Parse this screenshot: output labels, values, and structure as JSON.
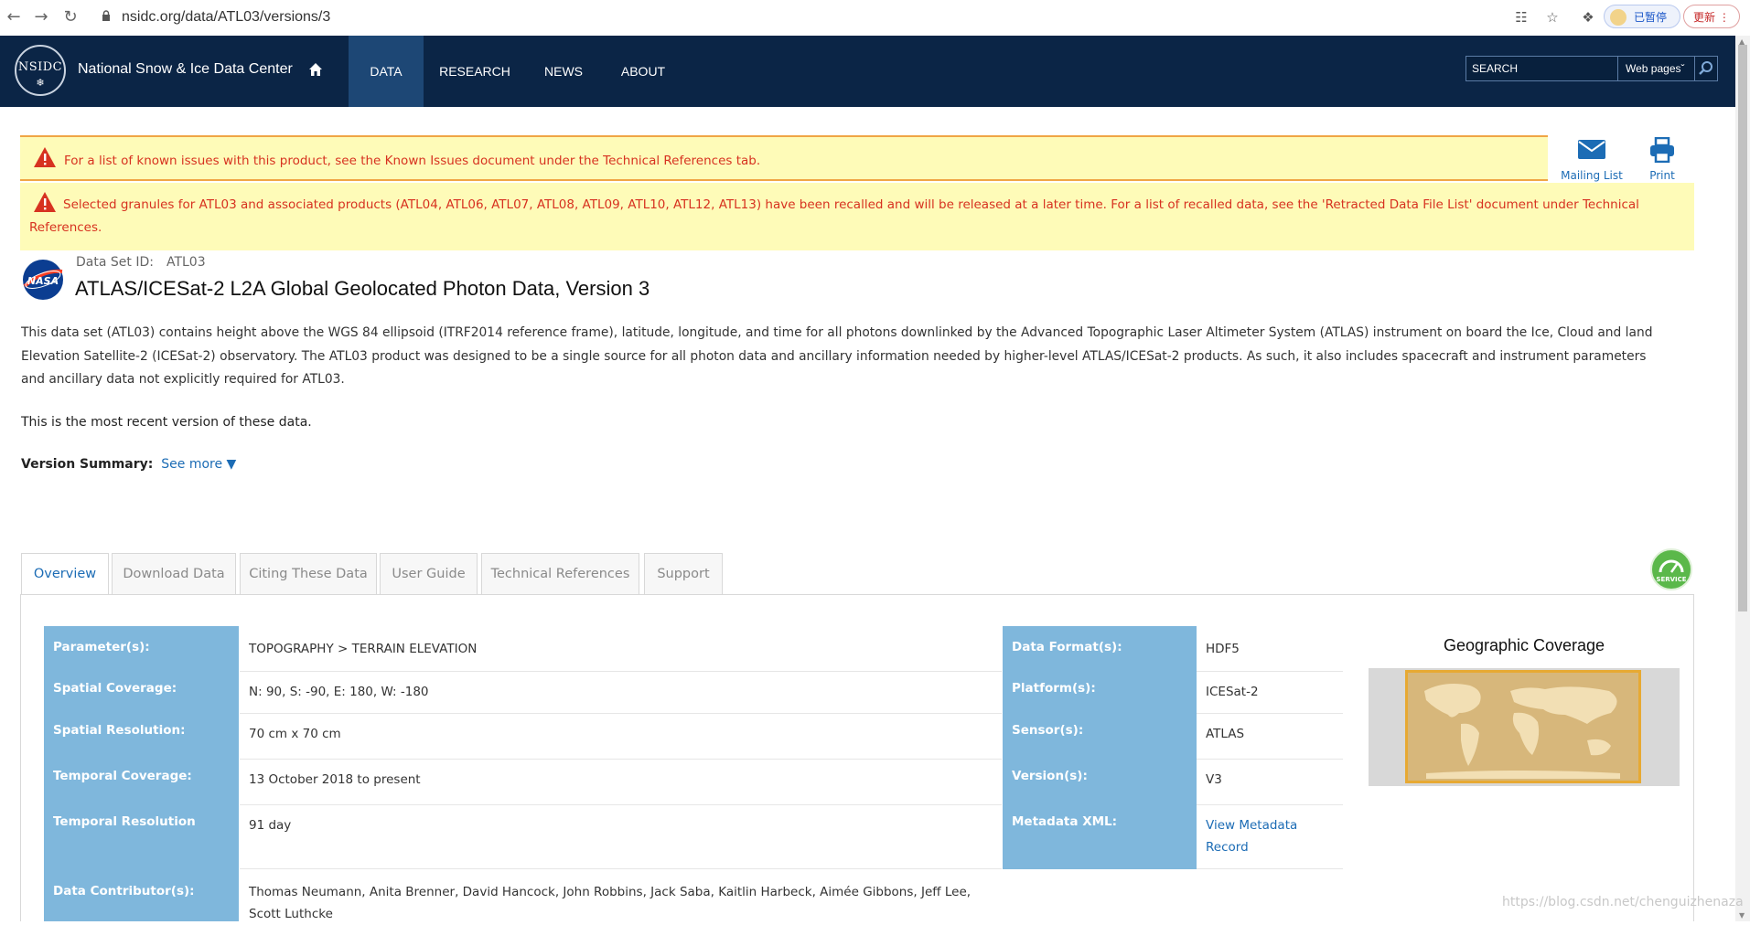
{
  "browser": {
    "url": "nsidc.org/data/ATL03/versions/3",
    "profile_label": "已暂停",
    "update_label": "更新"
  },
  "site": {
    "logo_text": "NSIDC",
    "name": "National Snow & Ice Data Center",
    "nav": [
      "DATA",
      "RESEARCH",
      "NEWS",
      "ABOUT"
    ],
    "active_nav": "DATA",
    "search_placeholder": "SEARCH",
    "search_scope": "Web pages"
  },
  "alerts": {
    "known_issues": "For a list of known issues with this product, see the Known Issues document under the Technical References tab.",
    "recalled": "Selected granules for ATL03 and associated products (ATL04, ATL06, ATL07, ATL08, ATL09, ATL10, ATL12, ATL13) have been recalled and will be released at a later time. For a list of recalled data, see the 'Retracted Data File List' document under Technical References."
  },
  "actions": {
    "mailing_list": "Mailing List",
    "print": "Print"
  },
  "dataset": {
    "id_label": "Data Set ID:",
    "id": "ATL03",
    "title": "ATLAS/ICESat-2 L2A Global Geolocated Photon Data, Version 3",
    "description": "This data set (ATL03) contains height above the WGS 84 ellipsoid (ITRF2014 reference frame), latitude, longitude, and time for all photons downlinked by the Advanced Topographic Laser Altimeter System (ATLAS) instrument on board the Ice, Cloud and land Elevation Satellite-2 (ICESat-2) observatory. The ATL03 product was designed to be a single source for all photon data and ancillary information needed by higher-level ATLAS/ICESat-2 products. As such, it also includes spacecraft and instrument parameters and ancillary data not explicitly required for ATL03.",
    "recent_note": "This is the most recent version of these data.",
    "version_summary_label": "Version Summary:",
    "see_more": "See more"
  },
  "tabs": [
    "Overview",
    "Download Data",
    "Citing These Data",
    "User Guide",
    "Technical References",
    "Support"
  ],
  "service_badge": "SERVICE",
  "overview_left": [
    {
      "label": "Parameter(s):",
      "value": "TOPOGRAPHY > TERRAIN ELEVATION"
    },
    {
      "label": "Spatial Coverage:",
      "value": "N: 90, S: -90, E: 180, W: -180"
    },
    {
      "label": "Spatial Resolution:",
      "value": "70 cm x 70 cm"
    },
    {
      "label": "Temporal Coverage:",
      "value": "13 October 2018 to present"
    },
    {
      "label": "Temporal Resolution",
      "value": "91 day"
    },
    {
      "label": "Data Contributor(s):",
      "value": "Thomas Neumann, Anita Brenner, David Hancock, John Robbins, Jack Saba, Kaitlin Harbeck, Aimée Gibbons, Jeff Lee, Scott Luthcke"
    }
  ],
  "overview_right": [
    {
      "label": "Data Format(s):",
      "value": "HDF5"
    },
    {
      "label": "Platform(s):",
      "value": "ICESat-2"
    },
    {
      "label": "Sensor(s):",
      "value": "ATLAS"
    },
    {
      "label": "Version(s):",
      "value": "V3"
    },
    {
      "label": "Metadata XML:",
      "value": "View Metadata Record"
    }
  ],
  "geographic_coverage_title": "Geographic Coverage",
  "watermark": "https://blog.csdn.net/chenguizhenaza"
}
